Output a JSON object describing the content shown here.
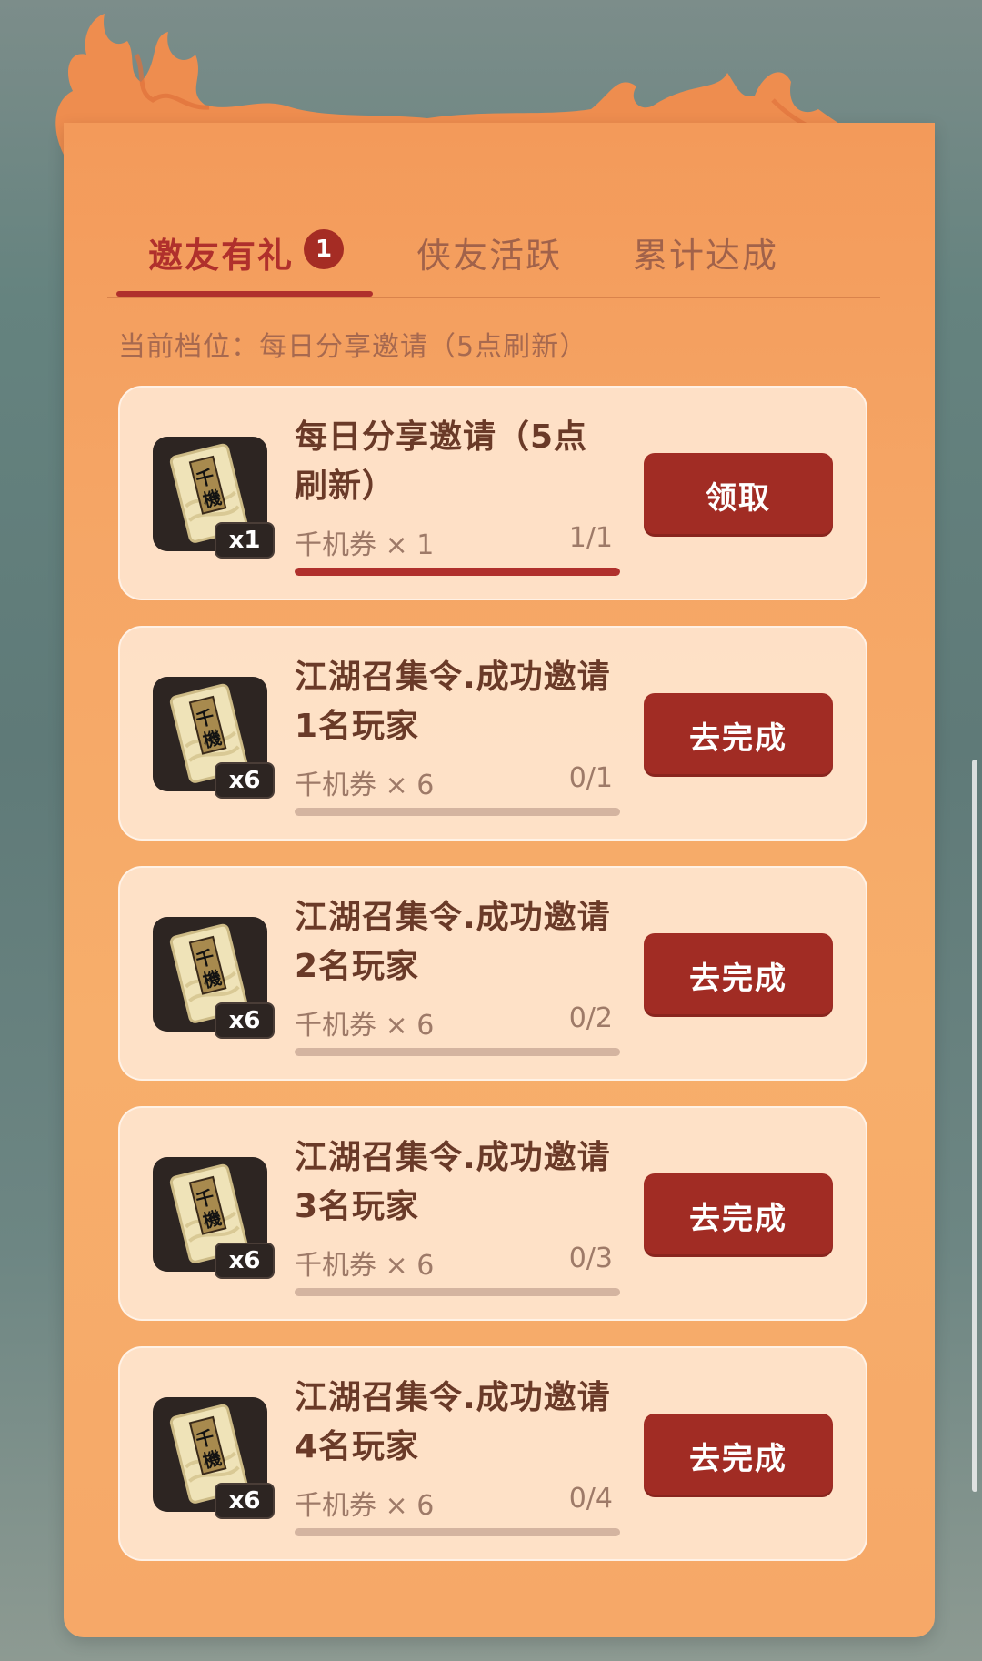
{
  "tabs": [
    {
      "label": "邀友有礼",
      "active": true,
      "badge": "1"
    },
    {
      "label": "侠友活跃",
      "active": false
    },
    {
      "label": "累计达成",
      "active": false
    }
  ],
  "tier": {
    "text": "当前档位：每日分享邀请（5点刷新）"
  },
  "tasks": [
    {
      "title": "每日分享邀请（5点刷新）",
      "reward": "千机券 × 1",
      "qty": "x1",
      "progress": "1/1",
      "fraction": 1.0,
      "button": "领取"
    },
    {
      "title": "江湖召集令.成功邀请1名玩家",
      "reward": "千机券 × 6",
      "qty": "x6",
      "progress": "0/1",
      "fraction": 0.0,
      "button": "去完成"
    },
    {
      "title": "江湖召集令.成功邀请2名玩家",
      "reward": "千机券 × 6",
      "qty": "x6",
      "progress": "0/2",
      "fraction": 0.0,
      "button": "去完成"
    },
    {
      "title": "江湖召集令.成功邀请3名玩家",
      "reward": "千机券 × 6",
      "qty": "x6",
      "progress": "0/3",
      "fraction": 0.0,
      "button": "去完成"
    },
    {
      "title": "江湖召集令.成功邀请4名玩家",
      "reward": "千机券 × 6",
      "qty": "x6",
      "progress": "0/4",
      "fraction": 0.0,
      "button": "去完成"
    }
  ],
  "reward_icon": {
    "glyph": "千機",
    "name": "qianji-ticket-icon"
  },
  "colors": {
    "accent": "#b0302c",
    "button": "#a12c24",
    "panel": "#f5a565"
  }
}
